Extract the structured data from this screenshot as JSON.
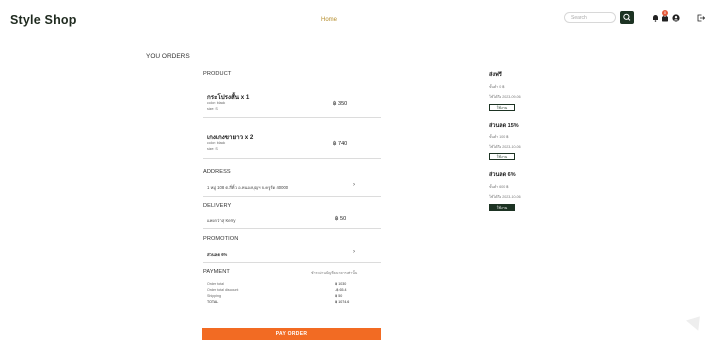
{
  "header": {
    "brand": "Style Shop",
    "nav_home": "Home",
    "search_placeholder": "Search",
    "cart_count": "0"
  },
  "page_title": "YOU ORDERS",
  "product": {
    "section_title": "PRODUCT",
    "items": [
      {
        "name": "กระโปรงสั้น x 1",
        "color": "color: black",
        "size": "size: S",
        "price": "฿ 350"
      },
      {
        "name": "เกงเกงขายาว x 2",
        "color": "color: black",
        "size": "size: S",
        "price": "฿ 740"
      }
    ]
  },
  "address": {
    "section_title": "ADDRESS",
    "value": "1 หมู่ 108 ต.สี่คิ้ว อ.หนองบุญฯ จ.ครูรัด 40000"
  },
  "delivery": {
    "section_title": "DELIVERY",
    "method": "แพงกว่าสุ Kerry",
    "price": "฿ 50"
  },
  "promotion": {
    "section_title": "PROMOTION",
    "value": "ส่วนลด 6%"
  },
  "payment": {
    "section_title": "PAYMENT",
    "method_note": "ชำระผ่านบัญชีธนาคารเท่านั้น",
    "rows": [
      {
        "label": "Order total",
        "value": "฿ 1030"
      },
      {
        "label": "Order total discount",
        "value": "-฿ 65.4"
      },
      {
        "label": "Shipping",
        "value": "฿ 50"
      },
      {
        "label": "TOTAL",
        "value": "฿ 1074.6"
      }
    ]
  },
  "pay_button": "PAY ORDER",
  "coupons": [
    {
      "title": "ส่งฟรี",
      "min": "ขั้นต่ำ 0 ฿",
      "expire": "ใช้ได้ถึง 2023-09-06",
      "button": "ใช้งาน",
      "active": false
    },
    {
      "title": "ส่วนลด 15%",
      "min": "ขั้นต่ำ 100 ฿",
      "expire": "ใช้ได้ถึง 2023-10-06",
      "button": "ใช้งาน",
      "active": false
    },
    {
      "title": "ส่วนลด 6%",
      "min": "ขั้นต่ำ 600 ฿",
      "expire": "ใช้ได้ถึง 2023-10-06",
      "button": "ใช้งาน",
      "active": true
    }
  ],
  "colors": {
    "accent": "#f26b23",
    "dark_green": "#1d3323"
  },
  "icons": [
    "search-icon",
    "bell-icon",
    "cart-icon",
    "user-icon",
    "logout-icon",
    "chevron-right-icon"
  ]
}
